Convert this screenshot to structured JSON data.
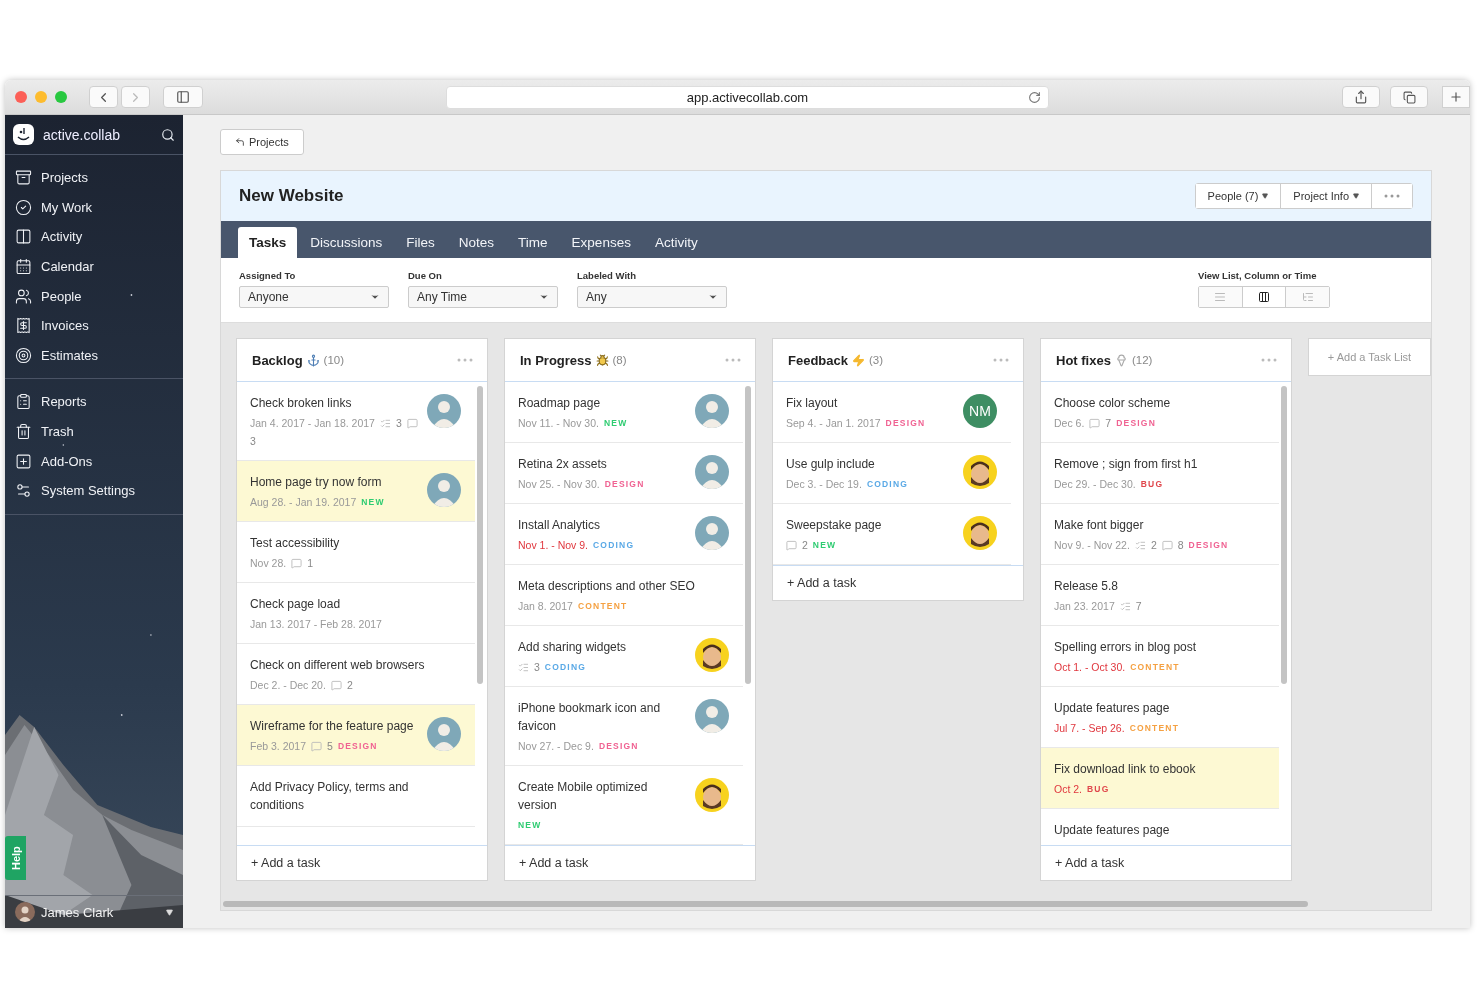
{
  "browser": {
    "url": "app.activecollab.com"
  },
  "sidebar": {
    "brand": "active.collab",
    "groups": [
      [
        {
          "label": "Projects"
        },
        {
          "label": "My Work"
        },
        {
          "label": "Activity"
        },
        {
          "label": "Calendar"
        },
        {
          "label": "People"
        },
        {
          "label": "Invoices"
        },
        {
          "label": "Estimates"
        }
      ],
      [
        {
          "label": "Reports"
        },
        {
          "label": "Trash"
        },
        {
          "label": "Add-Ons"
        },
        {
          "label": "System Settings"
        }
      ]
    ],
    "help": "Help",
    "user": {
      "name": "James Clark"
    }
  },
  "back_button": "Projects",
  "project": {
    "title": "New Website",
    "buttons": [
      "People (7)",
      "Project Info"
    ]
  },
  "tabs": [
    {
      "label": "Tasks",
      "selected": true
    },
    {
      "label": "Discussions",
      "selected": false
    },
    {
      "label": "Files",
      "selected": false
    },
    {
      "label": "Notes",
      "selected": false
    },
    {
      "label": "Time",
      "selected": false
    },
    {
      "label": "Expenses",
      "selected": false
    },
    {
      "label": "Activity",
      "selected": false
    }
  ],
  "filters": [
    {
      "label": "Assigned To",
      "value": "Anyone"
    },
    {
      "label": "Due On",
      "value": "Any Time"
    },
    {
      "label": "Labeled With",
      "value": "Any"
    }
  ],
  "view_switch": {
    "label": "View List, Column or Time",
    "options": [
      {
        "selected": false
      },
      {
        "selected": true
      },
      {
        "selected": false
      }
    ]
  },
  "lists": [
    {
      "name": "Backlog",
      "count": "(10)",
      "scrollable": true,
      "add": "+ Add a task",
      "tasks": [
        {
          "title": "Check broken links",
          "date": "Jan 4. 2017 - Jan 18. 2017",
          "overdue": false,
          "checklist": "3",
          "comments": "3",
          "highlighted": false
        },
        {
          "title": "Home page try now form",
          "date": "Aug 28. - Jan 19. 2017",
          "overdue": false,
          "label": {
            "text": "NEW",
            "color": "#2ecc71"
          },
          "highlighted": true
        },
        {
          "title": "Test accessibility",
          "date": "Nov 28.",
          "overdue": false,
          "comments": "1",
          "highlighted": false
        },
        {
          "title": "Check page load",
          "date": "Jan 13. 2017 - Feb 28. 2017",
          "overdue": false,
          "highlighted": false
        },
        {
          "title": "Check on different web browsers",
          "date": "Dec 2. - Dec 20.",
          "overdue": false,
          "comments": "2",
          "highlighted": false
        },
        {
          "title": "Wireframe for the feature page",
          "date": "Feb 3. 2017",
          "overdue": false,
          "comments": "5",
          "label": {
            "text": "DESIGN",
            "color": "#f06292"
          },
          "highlighted": true
        },
        {
          "title": "Add Privacy Policy, terms and conditions",
          "highlighted": false
        }
      ]
    },
    {
      "name": "In Progress",
      "count": "(8)",
      "scrollable": true,
      "add": "+ Add a task",
      "tasks": [
        {
          "title": "Roadmap page",
          "date": "Nov 11. - Nov 30.",
          "overdue": false,
          "label": {
            "text": "NEW",
            "color": "#2ecc71"
          },
          "highlighted": false
        },
        {
          "title": "Retina 2x assets",
          "date": "Nov 25. - Nov 30.",
          "overdue": false,
          "label": {
            "text": "DESIGN",
            "color": "#f06292"
          },
          "highlighted": false
        },
        {
          "title": "Install Analytics",
          "date": "Nov 1. - Nov 9.",
          "overdue": true,
          "label": {
            "text": "CODING",
            "color": "#5aa9e6"
          },
          "highlighted": false
        },
        {
          "title": "Meta descriptions and other SEO",
          "date": "Jan 8. 2017",
          "overdue": false,
          "label": {
            "text": "CONTENT",
            "color": "#f5a142"
          },
          "highlighted": false
        },
        {
          "title": "Add sharing widgets",
          "checklist": "3",
          "label": {
            "text": "CODING",
            "color": "#5aa9e6"
          },
          "highlighted": false,
          "avatar": {
            "kind": "cartoon"
          }
        },
        {
          "title": "iPhone bookmark icon and favicon",
          "date": "Nov 27. - Dec 9.",
          "overdue": false,
          "label": {
            "text": "DESIGN",
            "color": "#f06292"
          },
          "highlighted": false
        },
        {
          "title": "Create Mobile optimized version",
          "label": {
            "text": "NEW",
            "color": "#2ecc71"
          },
          "highlighted": false,
          "avatar": {
            "kind": "cartoon"
          }
        }
      ]
    },
    {
      "name": "Feedback",
      "count": "(3)",
      "scrollable": false,
      "add": "+ Add a task",
      "tasks": [
        {
          "title": "Fix layout",
          "date": "Sep 4. - Jan 1. 2017",
          "overdue": false,
          "label": {
            "text": "DESIGN",
            "color": "#f06292"
          },
          "highlighted": false,
          "avatar": {
            "kind": "initials",
            "text": "NM"
          }
        },
        {
          "title": "Use gulp include",
          "date": "Dec 3. - Dec 19.",
          "overdue": false,
          "label": {
            "text": "CODING",
            "color": "#5aa9e6"
          },
          "highlighted": false,
          "avatar": {
            "kind": "cartoon"
          }
        },
        {
          "title": "Sweepstake page",
          "comments": "2",
          "label": {
            "text": "NEW",
            "color": "#2ecc71"
          },
          "highlighted": false,
          "avatar": {
            "kind": "cartoon"
          }
        }
      ]
    },
    {
      "name": "Hot fixes",
      "count": "(12)",
      "scrollable": true,
      "add": "+ Add a task",
      "tasks": [
        {
          "title": "Choose color scheme",
          "date": "Dec 6.",
          "overdue": false,
          "comments": "7",
          "label": {
            "text": "DESIGN",
            "color": "#f06292"
          },
          "highlighted": false
        },
        {
          "title": "Remove ; sign from first h1",
          "date": "Dec 29. - Dec 30.",
          "overdue": false,
          "label": {
            "text": "BUG",
            "color": "#e0474c"
          },
          "highlighted": false
        },
        {
          "title": "Make font bigger",
          "date": "Nov 9. - Nov 22.",
          "overdue": false,
          "checklist": "2",
          "comments": "8",
          "label": {
            "text": "DESIGN",
            "color": "#f06292"
          },
          "highlighted": false
        },
        {
          "title": "Release 5.8",
          "date": "Jan 23. 2017",
          "overdue": false,
          "checklist": "7",
          "highlighted": false
        },
        {
          "title": "Spelling errors in blog post",
          "date": "Oct 1. - Oct 30.",
          "overdue": true,
          "label": {
            "text": "CONTENT",
            "color": "#f5a142"
          },
          "highlighted": false
        },
        {
          "title": "Update features page",
          "date": "Jul 7. - Sep 26.",
          "overdue": true,
          "label": {
            "text": "CONTENT",
            "color": "#f5a142"
          },
          "highlighted": false
        },
        {
          "title": "Fix download link to ebook",
          "date": "Oct 2.",
          "overdue": true,
          "label": {
            "text": "BUG",
            "color": "#e0474c"
          },
          "highlighted": true
        },
        {
          "title": "Update features page",
          "highlighted": false
        }
      ]
    }
  ],
  "add_list": "+ Add a Task List"
}
